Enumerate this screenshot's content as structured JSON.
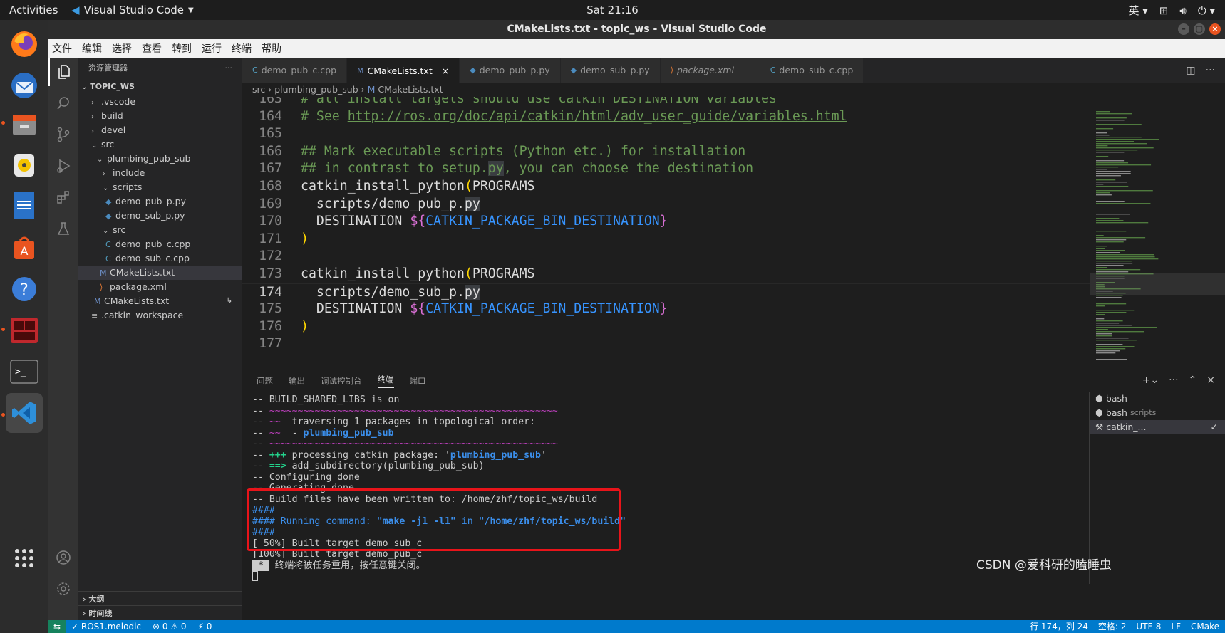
{
  "topbar": {
    "activities": "Activities",
    "app_name": "Visual Studio Code",
    "clock": "Sat 21:16",
    "input_method": "英"
  },
  "dock": {
    "items": [
      "firefox-icon",
      "thunderbird-icon",
      "files-icon",
      "rhythmbox-icon",
      "writer-icon",
      "software-icon",
      "help-icon",
      "terminator-icon",
      "terminal-icon",
      "vscode-icon",
      "show-apps-icon"
    ]
  },
  "window": {
    "title": "CMakeLists.txt - topic_ws - Visual Studio Code"
  },
  "menu": [
    "文件",
    "编辑",
    "选择",
    "查看",
    "转到",
    "运行",
    "终端",
    "帮助"
  ],
  "sidebar": {
    "header": "资源管理器",
    "more": "···",
    "workspace": "TOPIC_WS",
    "tree": [
      {
        "label": ".vscode",
        "kind": "folder",
        "open": false
      },
      {
        "label": "build",
        "kind": "folder",
        "open": false
      },
      {
        "label": "devel",
        "kind": "folder",
        "open": false
      },
      {
        "label": "src",
        "kind": "folder",
        "open": true
      },
      {
        "label": "plumbing_pub_sub",
        "kind": "folder",
        "open": true
      },
      {
        "label": "include",
        "kind": "folder",
        "open": false
      },
      {
        "label": "scripts",
        "kind": "folder",
        "open": true
      },
      {
        "label": "demo_pub_p.py",
        "kind": "py"
      },
      {
        "label": "demo_sub_p.py",
        "kind": "py"
      },
      {
        "label": "src",
        "kind": "folder",
        "open": true
      },
      {
        "label": "demo_pub_c.cpp",
        "kind": "cpp"
      },
      {
        "label": "demo_sub_c.cpp",
        "kind": "cpp"
      },
      {
        "label": "CMakeLists.txt",
        "kind": "cmake"
      },
      {
        "label": "package.xml",
        "kind": "xml"
      },
      {
        "label": "CMakeLists.txt",
        "kind": "cmake"
      },
      {
        "label": ".catkin_workspace",
        "kind": "text"
      }
    ],
    "outline": "大纲",
    "timeline": "时间线"
  },
  "tabs": [
    {
      "label": "demo_pub_c.cpp",
      "icon": "C"
    },
    {
      "label": "CMakeLists.txt",
      "icon": "M",
      "close": "×"
    },
    {
      "label": "demo_pub_p.py",
      "icon": "◆"
    },
    {
      "label": "demo_sub_p.py",
      "icon": "◆"
    },
    {
      "label": "package.xml",
      "icon": "⟩"
    },
    {
      "label": "demo_sub_c.cpp",
      "icon": "C"
    }
  ],
  "breadcrumb": {
    "parts": [
      "src",
      "plumbing_pub_sub",
      "CMakeLists.txt"
    ],
    "sep": "›"
  },
  "editor": {
    "lines": [
      {
        "n": "163"
      },
      {
        "n": "164"
      },
      {
        "n": "165"
      },
      {
        "n": "166"
      },
      {
        "n": "167"
      },
      {
        "n": "168"
      },
      {
        "n": "169"
      },
      {
        "n": "170"
      },
      {
        "n": "171"
      },
      {
        "n": "172"
      },
      {
        "n": "173"
      },
      {
        "n": "174"
      },
      {
        "n": "175"
      },
      {
        "n": "176"
      },
      {
        "n": "177"
      }
    ],
    "t163": "# all install targets should use catkin DESTINATION variables",
    "t164a": "# See ",
    "t164b": "http://ros.org/doc/api/catkin/html/adv_user_guide/variables.html",
    "t166": "## Mark executable scripts (Python etc.) for installation",
    "t167a": "## in contrast to setup.",
    "t167b": "py",
    "t167c": ", you can choose the destination",
    "fn": "catkin_install_python",
    "lparen": "(",
    "rparen": ")",
    "programs": "PROGRAMS",
    "pub_script_a": "  scripts/demo_pub_p.",
    "sub_script_a": "  scripts/demo_sub_p.",
    "py": "py",
    "dest": "  DESTINATION ",
    "dol": "${",
    "var": "CATKIN_PACKAGE_BIN_DESTINATION",
    "rbrace": "}"
  },
  "panel": {
    "tabs": [
      "问题",
      "输出",
      "调试控制台",
      "终端",
      "端口"
    ],
    "active_tab": "终端",
    "terminal": {
      "l1": "-- BUILD_SHARED_LIBS is on",
      "sep_prefix": "-- ",
      "sep": "~~~~~~~~~~~~~~~~~~~~~~~~~~~~~~~~~~~~~~~~~~~~~~~~~~~",
      "l3a": "-- ",
      "l3b": "~~",
      "l3c": "  traversing 1 packages in topological order:",
      "l4a": "-- ",
      "l4b": "~~",
      "l4c": "  - ",
      "l4d": "plumbing_pub_sub",
      "l6a": "-- ",
      "l6b": "+++",
      "l6c": " processing catkin package: '",
      "l6d": "plumbing_pub_sub",
      "l6e": "'",
      "l7a": "-- ",
      "l7b": "==>",
      "l7c": " add_subdirectory(plumbing_pub_sub)",
      "l8": "-- Configuring done",
      "l9": "-- Generating done",
      "l10": "-- Build files have been written to: /home/zhf/topic_ws/build",
      "hash": "####",
      "run_a": "#### Running command: ",
      "run_b": "\"make -j1 -l1\"",
      "run_c": " in ",
      "run_d": "\"/home/zhf/topic_ws/build\"",
      "b50": "[ 50%] Built target demo_sub_c",
      "b100": "[100%] Built target demo_pub_c",
      "star": " * ",
      "reuse": " 终端将被任务重用，按任意键关闭。"
    },
    "terminals": [
      {
        "label": "bash",
        "sub": ""
      },
      {
        "label": "bash",
        "sub": "scripts"
      },
      {
        "label": "catkin_...",
        "sub": "",
        "check": "✓"
      }
    ]
  },
  "status": {
    "remote": "⇆",
    "branch": "✓ ROS1.melodic",
    "problems": "⊗ 0 ⚠ 0",
    "ports": "⚡ 0",
    "position": "行 174，列 24",
    "spaces": "空格: 2",
    "encoding": "UTF-8",
    "eol": "LF",
    "language": "CMake"
  },
  "watermark": "CSDN @爱科研的瞌睡虫"
}
